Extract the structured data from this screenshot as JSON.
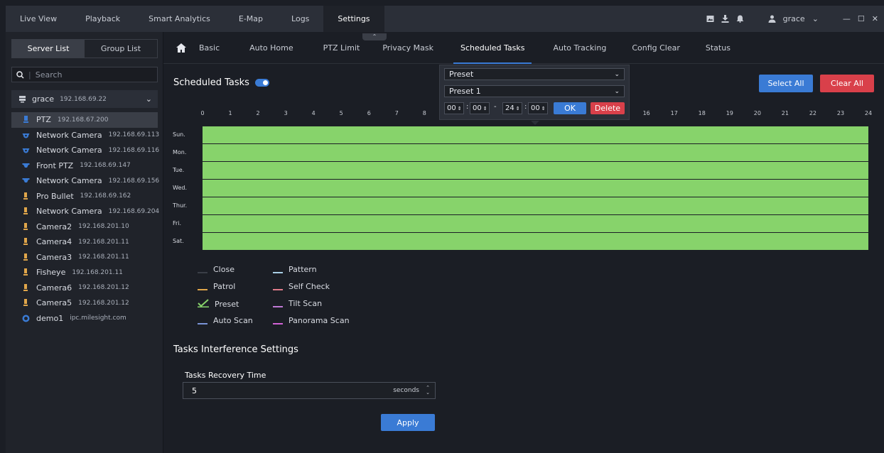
{
  "topbar": {
    "tabs": [
      "Live View",
      "Playback",
      "Smart Analytics",
      "E-Map",
      "Logs",
      "Settings"
    ],
    "active": "Settings",
    "user": "grace"
  },
  "sidebar": {
    "tabs": [
      "Server List",
      "Group List"
    ],
    "search_placeholder": "Search",
    "root": {
      "name": "grace",
      "ip": "192.168.69.22"
    },
    "devices": [
      {
        "name": "PTZ",
        "ip": "192.168.67.200",
        "icon": "ptz"
      },
      {
        "name": "Network Camera",
        "ip": "192.168.69.113",
        "icon": "dome"
      },
      {
        "name": "Network Camera",
        "ip": "192.168.69.116",
        "icon": "dome"
      },
      {
        "name": "Front PTZ",
        "ip": "192.168.69.147",
        "icon": "dome2"
      },
      {
        "name": "Network Camera",
        "ip": "192.168.69.156",
        "icon": "dome2"
      },
      {
        "name": "Pro Bullet",
        "ip": "192.168.69.162",
        "icon": "bullet"
      },
      {
        "name": "Network Camera",
        "ip": "192.168.69.204",
        "icon": "bullet"
      },
      {
        "name": "Camera2",
        "ip": "192.168.201.10",
        "icon": "bullet"
      },
      {
        "name": "Camera4",
        "ip": "192.168.201.11",
        "icon": "bullet"
      },
      {
        "name": "Camera3",
        "ip": "192.168.201.11",
        "icon": "bullet"
      },
      {
        "name": "Fisheye",
        "ip": "192.168.201.11",
        "icon": "bullet"
      },
      {
        "name": "Camera6",
        "ip": "192.168.201.12",
        "icon": "bullet"
      },
      {
        "name": "Camera5",
        "ip": "192.168.201.12",
        "icon": "bullet"
      },
      {
        "name": "demo1",
        "ip": "ipc.milesight.com",
        "icon": "cloud"
      }
    ]
  },
  "subtabs": [
    "Basic",
    "Auto Home",
    "PTZ Limit",
    "Privacy Mask",
    "Scheduled Tasks",
    "Auto Tracking",
    "Config Clear",
    "Status"
  ],
  "active_subtab": "Scheduled Tasks",
  "scheduled": {
    "title": "Scheduled Tasks",
    "enabled": true,
    "select_all": "Select All",
    "clear_all": "Clear All"
  },
  "popup": {
    "task": "Preset",
    "preset": "Preset 1",
    "start_h": "00",
    "start_m": "00",
    "end_h": "24",
    "end_m": "00",
    "sep": "-",
    "ok": "OK",
    "delete": "Delete"
  },
  "hours": [
    "0",
    "1",
    "2",
    "3",
    "4",
    "5",
    "6",
    "7",
    "8",
    "9",
    "10",
    "11",
    "12",
    "13",
    "14",
    "15",
    "16",
    "17",
    "18",
    "19",
    "20",
    "21",
    "22",
    "23",
    "24"
  ],
  "days": [
    "Sun.",
    "Mon.",
    "Tue.",
    "Wed.",
    "Thur.",
    "Fri.",
    "Sat."
  ],
  "legend": [
    {
      "label": "Close",
      "color": "#3a3e47"
    },
    {
      "label": "Pattern",
      "color": "#a9cfe6"
    },
    {
      "label": "Patrol",
      "color": "#e0a64a"
    },
    {
      "label": "Self Check",
      "color": "#e07b8a"
    },
    {
      "label": "Preset",
      "color": "#87d36b",
      "checked": true
    },
    {
      "label": "Tilt Scan",
      "color": "#c07ad6"
    },
    {
      "label": "Auto Scan",
      "color": "#7a93d6"
    },
    {
      "label": "Panorama Scan",
      "color": "#d262d6"
    }
  ],
  "interference": {
    "title": "Tasks Interference Settings",
    "label": "Tasks Recovery Time",
    "value": "5",
    "unit": "seconds",
    "apply": "Apply"
  },
  "colors": {
    "accent": "#3a7bd5",
    "danger": "#d9404a",
    "fill": "#87d36b"
  }
}
